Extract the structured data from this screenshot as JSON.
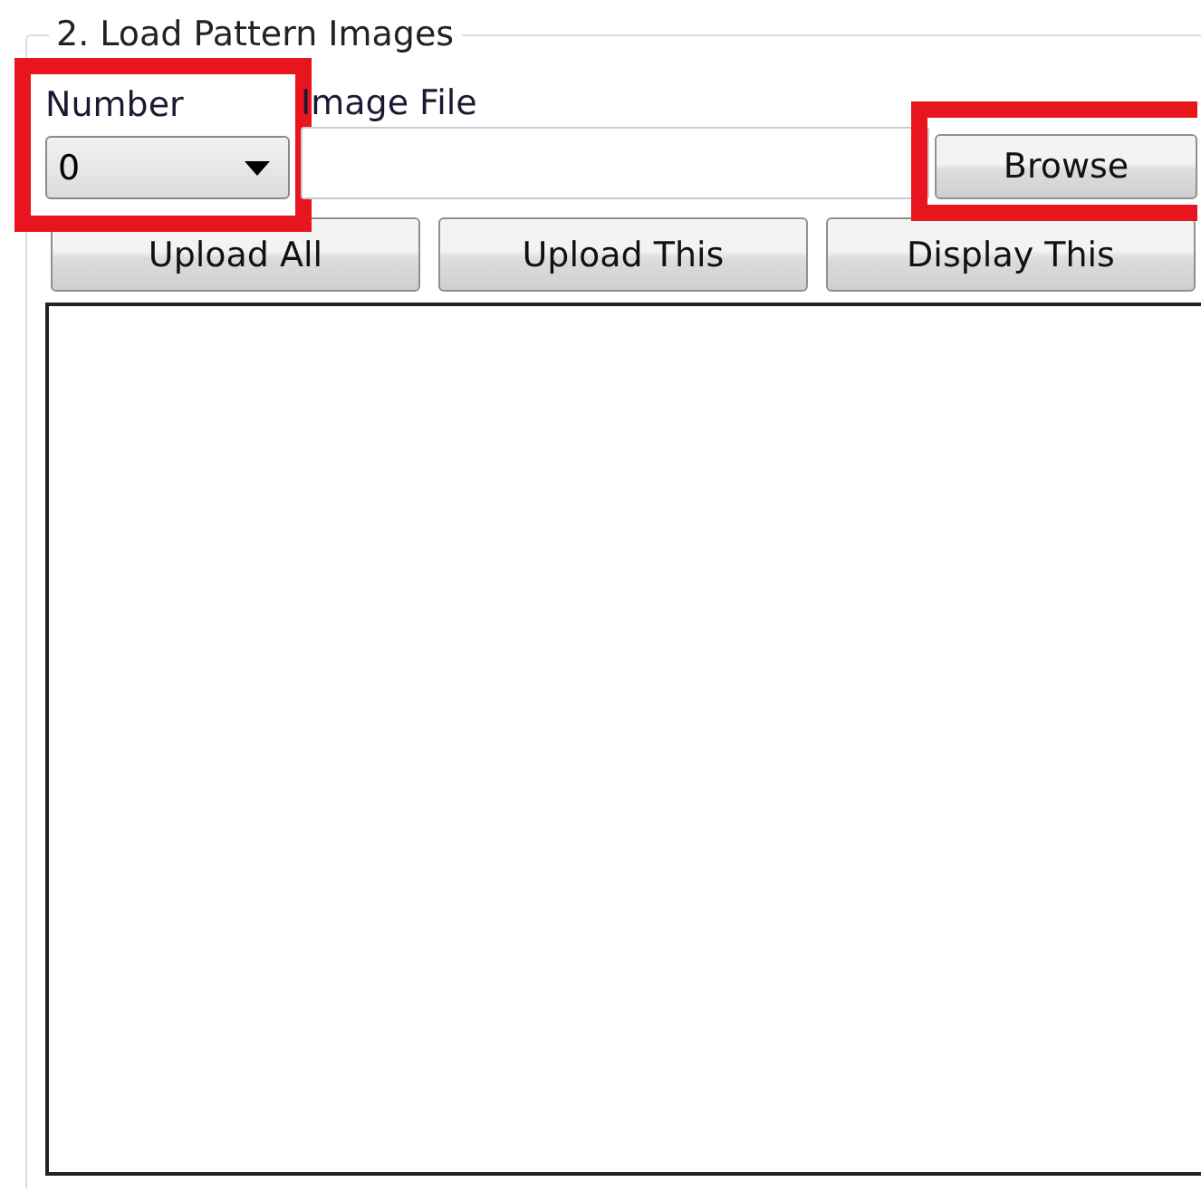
{
  "group": {
    "title": "2. Load Pattern Images"
  },
  "number": {
    "label": "Number",
    "value": "0",
    "highlighted": true
  },
  "image_file": {
    "label": "Image File"
  },
  "browse": {
    "label": "Browse",
    "highlighted": true
  },
  "buttons": [
    "Upload All",
    "Upload This",
    "Display This"
  ]
}
